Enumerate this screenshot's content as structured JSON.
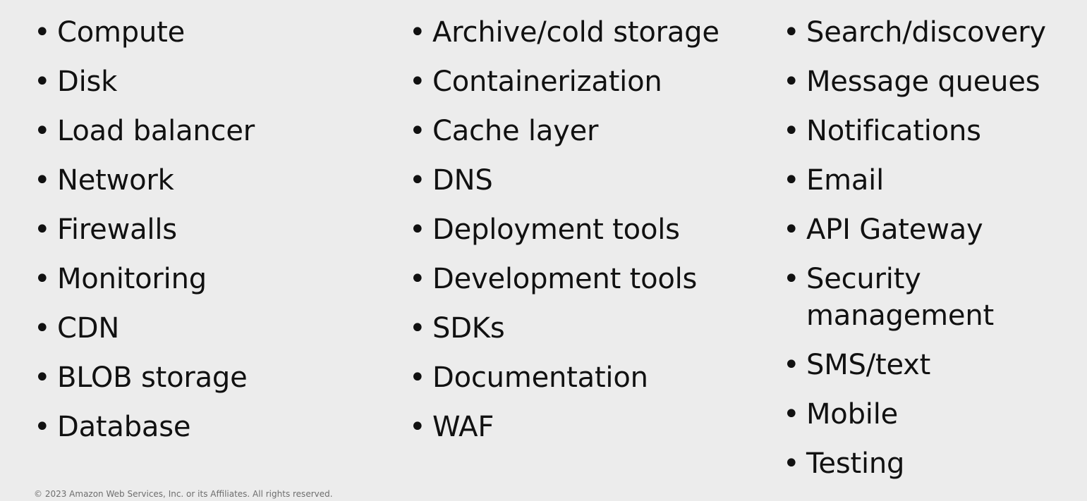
{
  "columns": [
    {
      "items": [
        "Compute",
        "Disk",
        "Load balancer",
        "Network",
        "Firewalls",
        "Monitoring",
        "CDN",
        "BLOB storage",
        "Database"
      ]
    },
    {
      "items": [
        "Archive/cold storage",
        "Containerization",
        "Cache layer",
        "DNS",
        "Deployment tools",
        "Development tools",
        "SDKs",
        "Documentation",
        "WAF"
      ]
    },
    {
      "items": [
        "Search/discovery",
        "Message queues",
        "Notifications",
        "Email",
        "API Gateway",
        "Security management",
        "SMS/text",
        "Mobile",
        "Testing"
      ]
    }
  ],
  "footer": {
    "copyright": "© 2023 Amazon Web Services, Inc. or its Affiliates. All rights reserved."
  }
}
